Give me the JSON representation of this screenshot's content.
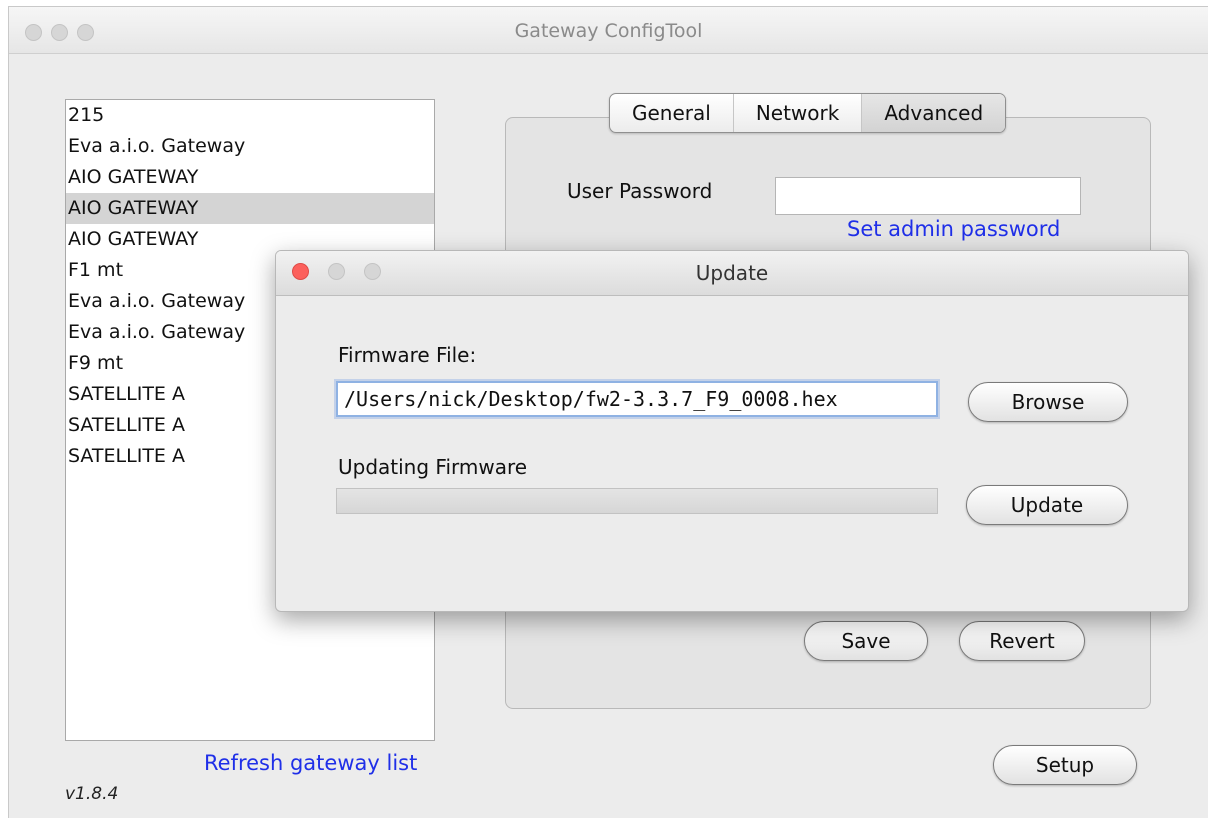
{
  "window": {
    "title": "Gateway ConfigTool"
  },
  "gateways": [
    "215",
    "Eva a.i.o. Gateway",
    "AIO GATEWAY",
    "AIO GATEWAY",
    "AIO GATEWAY",
    "F1 mt",
    "Eva a.i.o. Gateway",
    "Eva a.i.o. Gateway",
    "F9 mt",
    "SATELLITE A",
    "SATELLITE A",
    "SATELLITE A"
  ],
  "selected_gateway_index": 3,
  "refresh_link": "Refresh gateway list",
  "version": "v1.8.4",
  "tabs": [
    {
      "label": "General"
    },
    {
      "label": "Network"
    },
    {
      "label": "Advanced",
      "active": true
    }
  ],
  "advanced": {
    "user_password_label": "User Password",
    "user_password_value": "",
    "set_admin_link": "Set admin password",
    "save_label": "Save",
    "revert_label": "Revert"
  },
  "setup_label": "Setup",
  "update_dialog": {
    "title": "Update",
    "firmware_file_label": "Firmware File:",
    "firmware_file_value": "/Users/nick/Desktop/fw2-3.3.7_F9_0008.hex",
    "browse_label": "Browse",
    "updating_label": "Updating Firmware",
    "progress": 0,
    "update_label": "Update"
  },
  "colors": {
    "link": "#1f2fe8",
    "close_button": "#fc605c",
    "focus_ring": "#8fb2e3"
  }
}
